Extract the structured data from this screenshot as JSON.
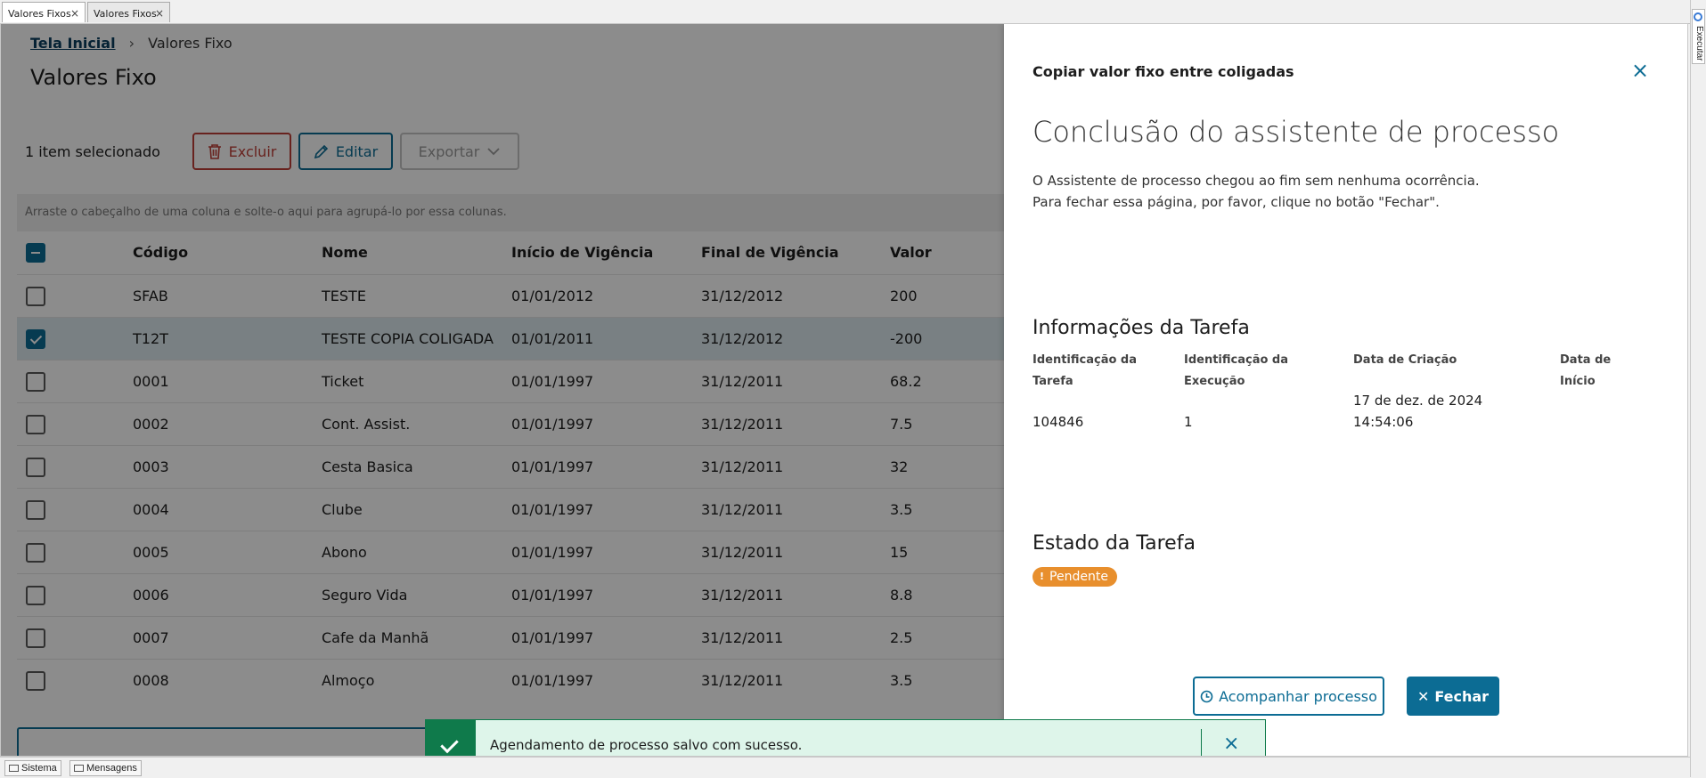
{
  "window_tabs": [
    {
      "label": "Valores Fixos",
      "close": "×"
    },
    {
      "label": "Valores Fixos",
      "close": "×"
    }
  ],
  "side_panel": {
    "label": "Executar"
  },
  "breadcrumb": {
    "home": "Tela Inicial",
    "separator": "›",
    "current": "Valores Fixo"
  },
  "page_title": "Valores Fixo",
  "toolbar": {
    "selected_count": "1 item selecionado",
    "delete_label": "Excluir",
    "edit_label": "Editar",
    "export_label": "Exportar"
  },
  "grid": {
    "group_hint": "Arraste o cabeçalho de uma coluna e solte-o aqui para agrupá-lo por essa colunas.",
    "columns": [
      "Código",
      "Nome",
      "Início de Vigência",
      "Final de Vigência",
      "Valor"
    ],
    "rows": [
      {
        "checked": false,
        "codigo": "SFAB",
        "nome": "TESTE",
        "inicio": "01/01/2012",
        "final": "31/12/2012",
        "valor": "200"
      },
      {
        "checked": true,
        "codigo": "T12T",
        "nome": "TESTE COPIA COLIGADA",
        "inicio": "01/01/2011",
        "final": "31/12/2012",
        "valor": "-200"
      },
      {
        "checked": false,
        "codigo": "0001",
        "nome": "Ticket",
        "inicio": "01/01/1997",
        "final": "31/12/2011",
        "valor": "68.2"
      },
      {
        "checked": false,
        "codigo": "0002",
        "nome": "Cont. Assist.",
        "inicio": "01/01/1997",
        "final": "31/12/2011",
        "valor": "7.5"
      },
      {
        "checked": false,
        "codigo": "0003",
        "nome": "Cesta Basica",
        "inicio": "01/01/1997",
        "final": "31/12/2011",
        "valor": "32"
      },
      {
        "checked": false,
        "codigo": "0004",
        "nome": "Clube",
        "inicio": "01/01/1997",
        "final": "31/12/2011",
        "valor": "3.5"
      },
      {
        "checked": false,
        "codigo": "0005",
        "nome": "Abono",
        "inicio": "01/01/1997",
        "final": "31/12/2011",
        "valor": "15"
      },
      {
        "checked": false,
        "codigo": "0006",
        "nome": "Seguro Vida",
        "inicio": "01/01/1997",
        "final": "31/12/2011",
        "valor": "8.8"
      },
      {
        "checked": false,
        "codigo": "0007",
        "nome": "Cafe da Manhã",
        "inicio": "01/01/1997",
        "final": "31/12/2011",
        "valor": "2.5"
      },
      {
        "checked": false,
        "codigo": "0008",
        "nome": "Almoço",
        "inicio": "01/01/1997",
        "final": "31/12/2011",
        "valor": "3.5"
      }
    ]
  },
  "drawer": {
    "title": "Copiar valor fixo entre coligadas",
    "close": "×",
    "heading": "Conclusão do assistente de processo",
    "line1": "O Assistente de processo chegou ao fim sem nenhuma ocorrência.",
    "line2": "Para fechar essa página, por favor, clique no botão \"Fechar\".",
    "info_title": "Informações da Tarefa",
    "fields": {
      "tarefa_label_1": "Identificação da",
      "tarefa_label_2": "Tarefa",
      "tarefa_value": "104846",
      "execucao_label_1": "Identificação da",
      "execucao_label_2": "Execução",
      "execucao_value": "1",
      "criacao_label": "Data de Criação",
      "criacao_value_1": "17 de dez. de 2024",
      "criacao_value_2": "14:54:06",
      "inicio_label_1": "Data de",
      "inicio_label_2": "Início"
    },
    "state_title": "Estado da Tarefa",
    "state_badge": "Pendente",
    "follow_button": "Acompanhar processo",
    "close_button": "Fechar"
  },
  "toast": {
    "message": "Agendamento de processo salvo com sucesso.",
    "close": "×"
  },
  "statusbar": {
    "tab1": "Sistema",
    "tab2": "Mensagens"
  },
  "colors": {
    "primary": "#0c6c94",
    "danger": "#be3e37",
    "success": "#0f7a4b",
    "warning": "#e88f2d"
  }
}
